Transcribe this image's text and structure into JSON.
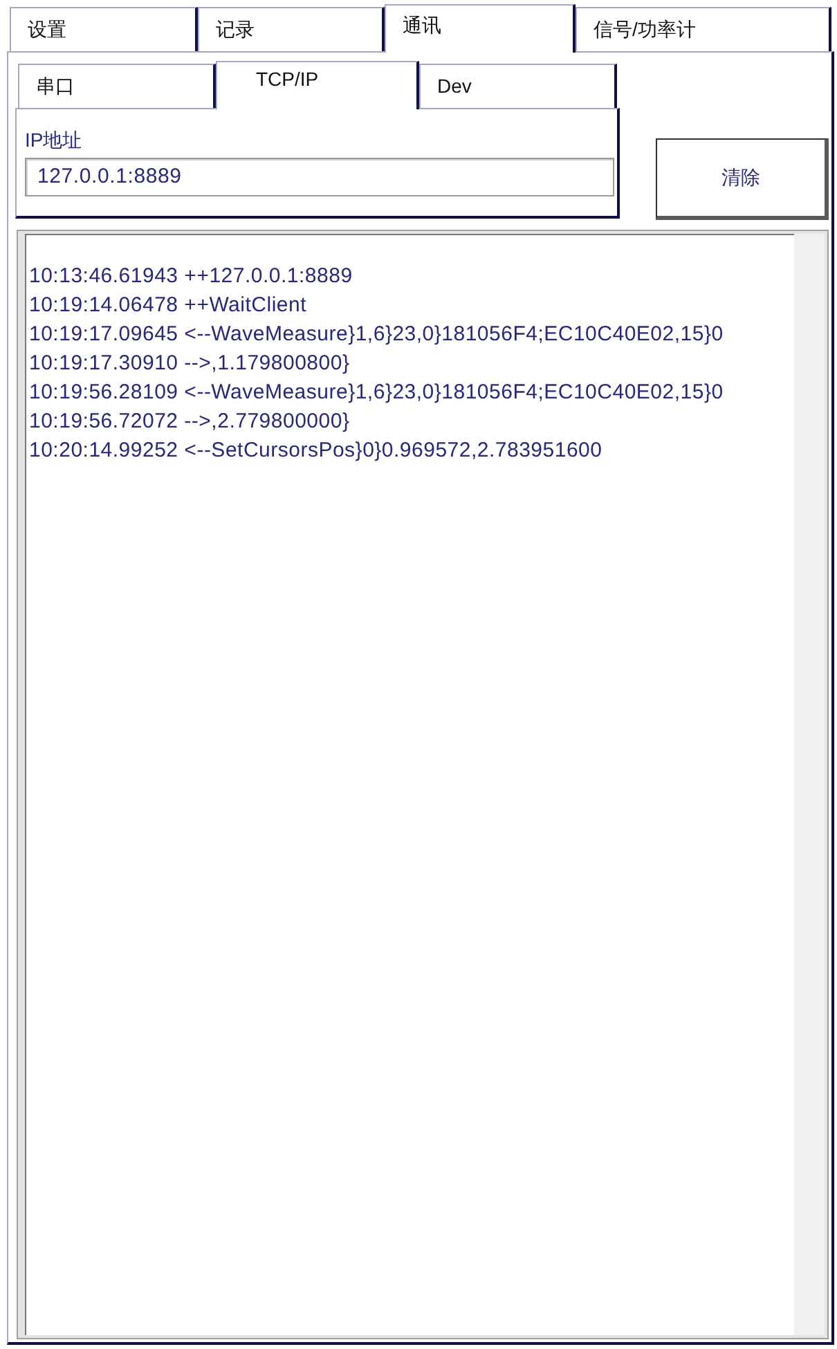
{
  "tabs": [
    {
      "label": "设置",
      "selected": false
    },
    {
      "label": "记录",
      "selected": false
    },
    {
      "label": "通讯",
      "selected": true
    },
    {
      "label": "信号/功率计",
      "selected": false
    }
  ],
  "sub_tabs": [
    {
      "label": "串口",
      "selected": false
    },
    {
      "label": "TCP/IP",
      "selected": true
    },
    {
      "label": "Dev",
      "selected": false
    }
  ],
  "ip_field": {
    "label": "IP地址",
    "value": "127.0.0.1:8889"
  },
  "clear_button": {
    "label": "清除"
  },
  "log": {
    "lines": [
      "10:13:46.61943 ++127.0.0.1:8889",
      "10:19:14.06478 ++WaitClient",
      "10:19:17.09645 <--WaveMeasure}1,6}23,0}181056F4;EC10C40E02,15}0",
      "10:19:17.30910 -->,1.179800800}",
      "10:19:56.28109 <--WaveMeasure}1,6}23,0}181056F4;EC10C40E02,15}0",
      "10:19:56.72072 -->,2.779800000}",
      "10:20:14.99252 <--SetCursorsPos}0}0.969572,2.783951600"
    ]
  }
}
